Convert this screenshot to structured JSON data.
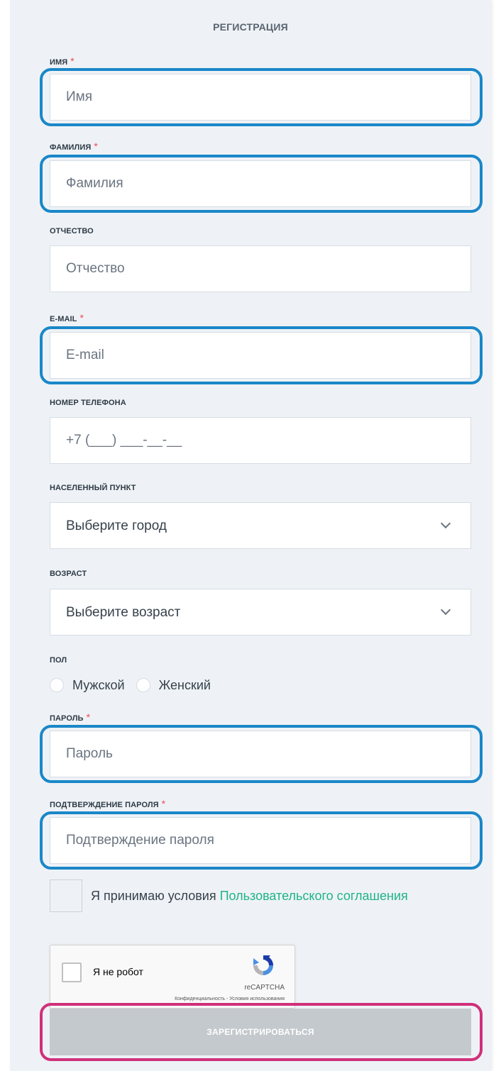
{
  "form": {
    "title": "РЕГИСТРАЦИЯ",
    "required_mark": "*",
    "first_name": {
      "label": "ИМЯ",
      "placeholder": "Имя"
    },
    "last_name": {
      "label": "ФАМИЛИЯ",
      "placeholder": "Фамилия"
    },
    "middle_name": {
      "label": "ОТЧЕСТВО",
      "placeholder": "Отчество"
    },
    "email": {
      "label": "E-MAIL",
      "placeholder": "E-mail"
    },
    "phone": {
      "label": "НОМЕР ТЕЛЕФОНА",
      "placeholder": "+7 (___) ___-__-__"
    },
    "city": {
      "label": "НАСЕЛЕННЫЙ ПУНКТ",
      "selected": "Выберите город"
    },
    "age": {
      "label": "ВОЗРАСТ",
      "selected": "Выберите возраст"
    },
    "gender": {
      "label": "ПОЛ",
      "options": [
        "Мужской",
        "Женский"
      ]
    },
    "password": {
      "label": "ПАРОЛЬ",
      "placeholder": "Пароль"
    },
    "password_confirm": {
      "label": "ПОДТВЕРЖДЕНИЕ ПАРОЛЯ",
      "placeholder": "Подтверждение пароля"
    },
    "agreement": {
      "text": "Я принимаю условия ",
      "link": "Пользовательского соглашения"
    },
    "submit_label": "ЗАРЕГИСТРИРОВАТЬСЯ"
  },
  "recaptcha": {
    "label": "Я не робот",
    "brand": "reCAPTCHA",
    "terms": "Конфиденциальность - Условия использования"
  },
  "colors": {
    "highlight_fields": "#1a87c8",
    "highlight_submit": "#d0307a",
    "link": "#20b389",
    "required": "#f04a58",
    "submit_disabled": "#c3c9cd"
  }
}
